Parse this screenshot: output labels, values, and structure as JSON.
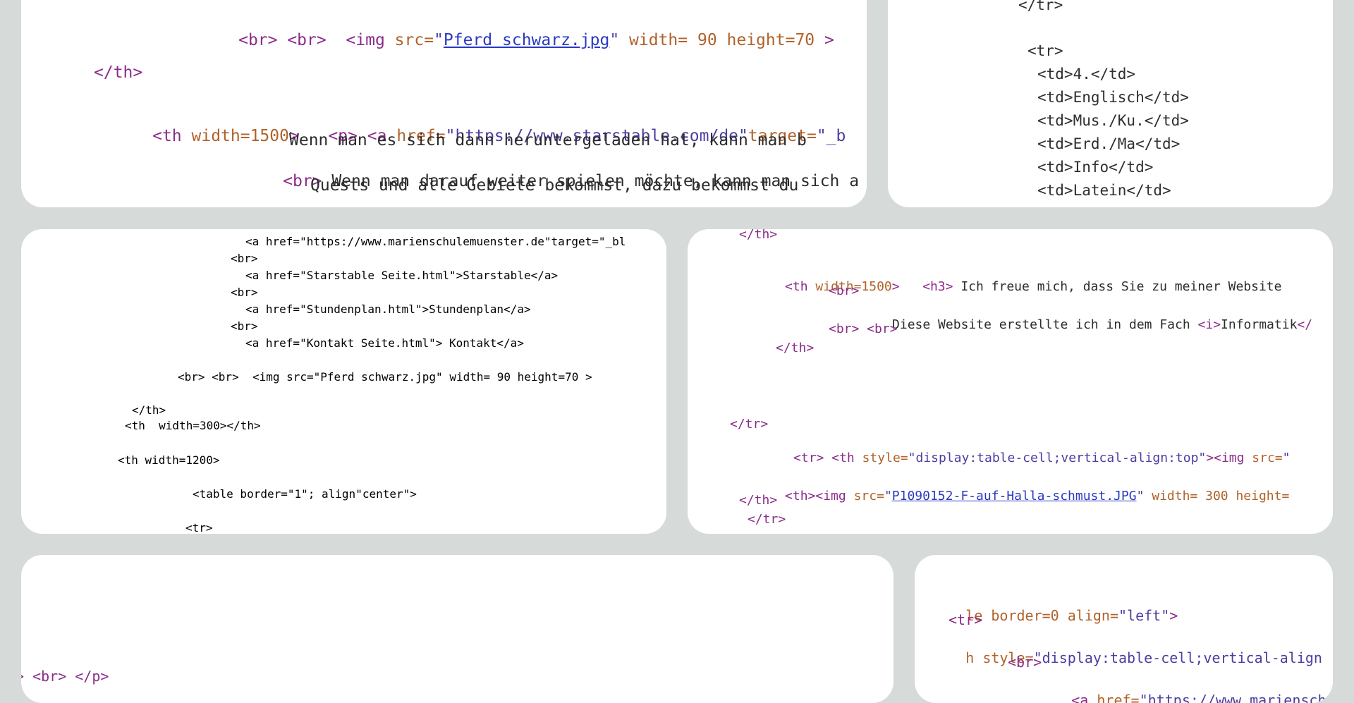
{
  "panel_top_left": {
    "lines": [
      [
        "<br> <br>  <img src=\"",
        "Pferd schwarz.jpg",
        "\" width= 90 height=70 >"
      ],
      [
        "</th>"
      ],
      [
        "<th width=1500>   <p> <a href=\"https://www.starstable.com/de\"target=\"_b"
      ],
      [
        "Wenn man es sich dann heruntergeladen hat, kann man b"
      ],
      [
        "<br> Wenn man darauf weiter spielen möchte, kann man sich a"
      ],
      [
        "Quests und alle Gebiete bekommst, dazu bekommst du"
      ]
    ]
  },
  "panel_top_right": {
    "lines": [
      "</tr>",
      "<tr>",
      "<td>4.</td>",
      "<td>Englisch</td>",
      "<td>Mus./Ku.</td>",
      "<td>Erd./Ma</td>",
      "<td>Info</td>",
      "<td>Latein</td>"
    ]
  },
  "panel_middle_left": {
    "lines": [
      "<a href=\"https://www.marienschulemuenster.de\"target=\"_bl",
      "<br>",
      "<a href=\"Starstable Seite.html\">Starstable</a>",
      "<br>",
      "<a href=\"Stundenplan.html\">Stundenplan</a>",
      "<br>",
      "<a href=\"Kontakt Seite.html\"> Kontakt</a>",
      "<br> <br>  <img src=\"Pferd schwarz.jpg\" width= 90 height=70 >",
      "</th>",
      "<th  width=300></th>",
      "<th width=1200>",
      "<table border=\"1\"; align\"center\">",
      "<tr>"
    ]
  },
  "panel_middle_right": {
    "lines": [
      "</th>",
      "<th width=1500>   <h3> Ich freue mich, dass Sie zu meiner Website",
      "<br>",
      "Diese Website erstellte ich in dem Fach <i>Informatik</",
      "<br> <br>",
      "</th>",
      "</tr>",
      "<tr> <th style=\"display:table-cell;vertical-align:top\"><img src=\"",
      "<th><img src=\"P1090152-F-auf-Halla-schmust.JPG\" width= 300 height=",
      "</th>",
      "</tr>"
    ]
  },
  "panel_bottom_left": {
    "lines": [
      "> <br> </p>"
    ]
  },
  "panel_bottom_right": {
    "lines": [
      "le border=0 align=\"left\">",
      "<tr>",
      "h style=\"display:table-cell;vertical-align",
      "<br>",
      "<a href=\"https://www.marienschule"
    ]
  }
}
